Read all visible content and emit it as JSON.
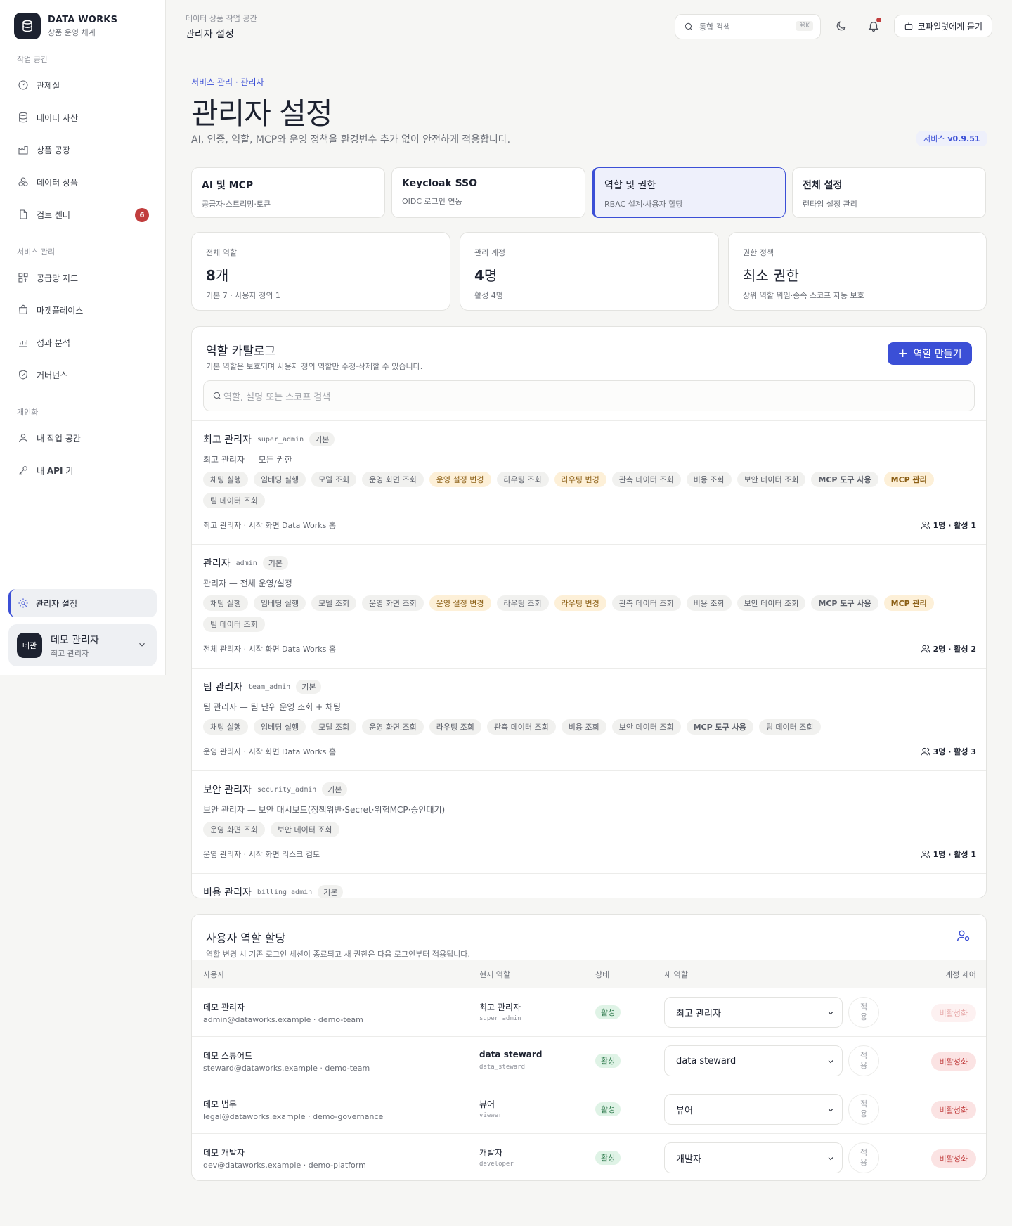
{
  "brand": {
    "name": "DATA WORKS",
    "sub": "상품 운영 체계"
  },
  "sidebar": {
    "sections": [
      {
        "label": "작업 공간"
      },
      {
        "label": "서비스 관리"
      },
      {
        "label": "개인화"
      }
    ],
    "items": [
      {
        "label": "관제실",
        "icon": "gauge-icon"
      },
      {
        "label": "데이터 자산",
        "icon": "database-icon"
      },
      {
        "label": "상품 공장",
        "icon": "factory-icon"
      },
      {
        "label": "데이터 상품",
        "icon": "boxes-icon"
      },
      {
        "label": "검토 센터",
        "icon": "document-icon",
        "badge": "6"
      },
      {
        "label": "공급망 지도",
        "icon": "network-icon"
      },
      {
        "label": "마켓플레이스",
        "icon": "store-icon"
      },
      {
        "label": "성과 분석",
        "icon": "chart-icon"
      },
      {
        "label": "거버넌스",
        "icon": "shield-icon"
      },
      {
        "label": "내 작업 공간",
        "icon": "user-icon"
      },
      {
        "label": "내 API 키",
        "label_prefix": "내 ",
        "label_bold": "API",
        "label_suffix": " 키",
        "icon": "key-icon"
      }
    ],
    "active": {
      "label": "관리자 설정",
      "icon": "gear-icon"
    },
    "user": {
      "avatar": "데관",
      "name": "데모 관리자",
      "role": "최고 관리자"
    }
  },
  "topbar": {
    "crumb": "데이터 상품 작업 공간",
    "title": "관리자 설정",
    "search_placeholder": "통합 검색",
    "search_kbd": "⌘K",
    "copilot_label": "코파일럿에게 묻기"
  },
  "main": {
    "crumb": "서비스 관리 · 관리자",
    "title": "관리자 설정",
    "desc": "AI, 인증, 역할, MCP와 운영 정책을 환경변수 추가 없이 안전하게 적용합니다.",
    "version_label": "서비스",
    "version": "v0.9.51"
  },
  "tabs": [
    {
      "title": "AI 및 MCP",
      "sub": "공급자·스트리밍·토큰"
    },
    {
      "title": "Keycloak SSO",
      "sub": "OIDC 로그인 연동"
    },
    {
      "title": "역할 및 권한",
      "sub": "RBAC 설계·사용자 할당",
      "active": true
    },
    {
      "title": "전체 설정",
      "sub": "런타임 설정 관리"
    }
  ],
  "stats": [
    {
      "label": "전체 역할",
      "value_num": "8",
      "value_unit": "개",
      "sub": "기본 7 · 사용자 정의 1"
    },
    {
      "label": "관리 계정",
      "value_num": "4",
      "value_unit": "명",
      "sub": "활성 4명"
    },
    {
      "label": "권한 정책",
      "value_num": "",
      "value_unit": "최소 권한",
      "sub": "상위 역할 위임·종속 스코프 자동 보호"
    }
  ],
  "catalog": {
    "title": "역할 카탈로그",
    "sub": "기본 역할은 보호되며 사용자 정의 역할만 수정·삭제할 수 있습니다.",
    "create_label": "역할 만들기",
    "search_placeholder": "역할, 설명 또는 스코프 검색",
    "roles": [
      {
        "name": "최고 관리자",
        "code": "super_admin",
        "tag": "기본",
        "desc": "최고 관리자 — 모든 권한",
        "chips": [
          {
            "t": "채팅 실행"
          },
          {
            "t": "임베딩 실행"
          },
          {
            "t": "모델 조회"
          },
          {
            "t": "운영 화면 조회"
          },
          {
            "t": "운영 설정 변경",
            "warn": true
          },
          {
            "t": "라우팅 조회"
          },
          {
            "t": "라우팅 변경",
            "warn": true
          },
          {
            "t": "관측 데이터 조회"
          },
          {
            "t": "비용 조회"
          },
          {
            "t": "보안 데이터 조회"
          },
          {
            "t": "MCP 도구 사용",
            "bold": true
          },
          {
            "t": "MCP 관리",
            "warn": true,
            "bold": true
          },
          {
            "t": "팀 데이터 조회"
          }
        ],
        "foot": "최고 관리자 · 시작 화면 Data Works 홈",
        "count": "1명 · 활성 1"
      },
      {
        "name": "관리자",
        "code": "admin",
        "tag": "기본",
        "desc": "관리자 — 전체 운영/설정",
        "chips": [
          {
            "t": "채팅 실행"
          },
          {
            "t": "임베딩 실행"
          },
          {
            "t": "모델 조회"
          },
          {
            "t": "운영 화면 조회"
          },
          {
            "t": "운영 설정 변경",
            "warn": true
          },
          {
            "t": "라우팅 조회"
          },
          {
            "t": "라우팅 변경",
            "warn": true
          },
          {
            "t": "관측 데이터 조회"
          },
          {
            "t": "비용 조회"
          },
          {
            "t": "보안 데이터 조회"
          },
          {
            "t": "MCP 도구 사용",
            "bold": true
          },
          {
            "t": "MCP 관리",
            "warn": true,
            "bold": true
          },
          {
            "t": "팀 데이터 조회"
          }
        ],
        "foot": "전체 관리자 · 시작 화면 Data Works 홈",
        "count": "2명 · 활성 2"
      },
      {
        "name": "팀 관리자",
        "code": "team_admin",
        "tag": "기본",
        "desc": "팀 관리자 — 팀 단위 운영 조회 + 채팅",
        "chips": [
          {
            "t": "채팅 실행"
          },
          {
            "t": "임베딩 실행"
          },
          {
            "t": "모델 조회"
          },
          {
            "t": "운영 화면 조회"
          },
          {
            "t": "라우팅 조회"
          },
          {
            "t": "관측 데이터 조회"
          },
          {
            "t": "비용 조회"
          },
          {
            "t": "보안 데이터 조회"
          },
          {
            "t": "MCP 도구 사용",
            "bold": true
          },
          {
            "t": "팀 데이터 조회"
          }
        ],
        "foot": "운영 관리자 · 시작 화면 Data Works 홈",
        "count": "3명 · 활성 3"
      },
      {
        "name": "보안 관리자",
        "code": "security_admin",
        "tag": "기본",
        "desc": "보안 관리자 — 보안 대시보드(정책위반·Secret·위험MCP·승인대기)",
        "chips": [
          {
            "t": "운영 화면 조회"
          },
          {
            "t": "보안 데이터 조회"
          }
        ],
        "foot": "운영 관리자 · 시작 화면 리스크 검토",
        "count": "1명 · 활성 1"
      },
      {
        "name": "비용 관리자",
        "code": "billing_admin",
        "tag": "기본",
        "desc": "",
        "chips": [],
        "foot": "",
        "count": ""
      }
    ]
  },
  "assign": {
    "title": "사용자 역할 할당",
    "sub": "역할 변경 시 기존 로그인 세션이 종료되고 새 권한은 다음 로그인부터 적용됩니다.",
    "headers": {
      "user": "사용자",
      "current": "현재 역할",
      "status": "상태",
      "new_role": "새 역할",
      "control": "계정 제어"
    },
    "apply_label": "적용",
    "rows": [
      {
        "name": "데모 관리자",
        "mail": "admin@dataworks.example · demo-team",
        "role": "최고 관리자",
        "code": "super_admin",
        "status": "활성",
        "select": "최고 관리자",
        "deact": "비활성화",
        "dim": true
      },
      {
        "name": "데모 스튜어드",
        "mail": "steward@dataworks.example · demo-team",
        "role": "data steward",
        "code": "data_steward",
        "status": "활성",
        "select": "data steward",
        "deact": "비활성화",
        "bold": true
      },
      {
        "name": "데모 법무",
        "mail": "legal@dataworks.example · demo-governance",
        "role": "뷰어",
        "code": "viewer",
        "status": "활성",
        "select": "뷰어",
        "deact": "비활성화"
      },
      {
        "name": "데모 개발자",
        "mail": "dev@dataworks.example · demo-platform",
        "role": "개발자",
        "code": "developer",
        "status": "활성",
        "select": "개발자",
        "deact": "비활성화"
      }
    ]
  },
  "colors": {
    "accent": "#3b4fd6",
    "warn_chip": "#fdf0d8",
    "danger": "#c13d3d",
    "success": "#2f7a4d"
  }
}
